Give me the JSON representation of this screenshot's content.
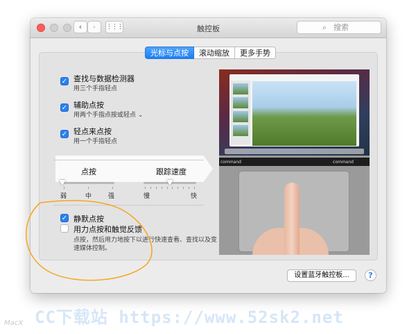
{
  "window": {
    "title": "触控板",
    "search_placeholder": "搜索",
    "nav": {
      "back": "‹",
      "forward": "›",
      "grid": "⋮⋮⋮"
    }
  },
  "tabs": [
    {
      "label": "光标与点按",
      "active": true
    },
    {
      "label": "滚动缩放",
      "active": false
    },
    {
      "label": "更多手势",
      "active": false
    }
  ],
  "options": [
    {
      "title": "查找与数据检测器",
      "subtitle": "用三个手指轻点",
      "checked": true
    },
    {
      "title": "辅助点按",
      "subtitle": "用两个手指点按或轻点 ⌄",
      "checked": true
    },
    {
      "title": "轻点来点按",
      "subtitle": "用一个手指轻点",
      "checked": true,
      "selected": true
    }
  ],
  "sliders": {
    "click": {
      "label": "点按",
      "ticks": [
        "弱",
        "中",
        "强"
      ],
      "level": 0
    },
    "tracking": {
      "label": "跟踪速度",
      "ticks": [
        "慢",
        "快"
      ],
      "level": 0.5
    }
  },
  "bottom_options": [
    {
      "title": "静默点按",
      "checked": true
    },
    {
      "title": "用力点按和触觉反馈",
      "checked": false
    }
  ],
  "description": [
    "点按，然后用力地按下以进行快速查看、查找以及变",
    "速媒体控制。"
  ],
  "preview_keys": {
    "left": "command",
    "right": "command"
  },
  "buttons": {
    "bluetooth": "设置蓝牙触控板...",
    "help": "?"
  },
  "colors": {
    "accent": "#2b80f0",
    "annotation": "#f5a623",
    "watermark": "#d6e6f7"
  },
  "watermark": "CC下载站 https://www.52sk2.net",
  "corner_mark": "MacX"
}
